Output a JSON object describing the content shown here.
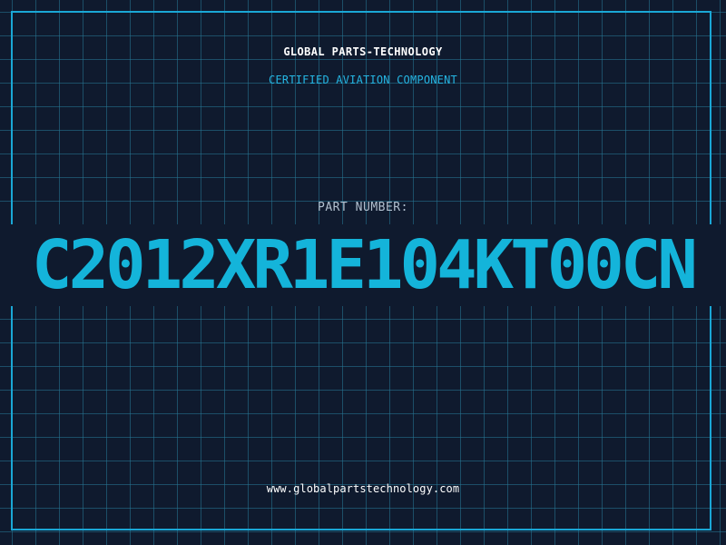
{
  "header": {
    "company": "GLOBAL PARTS-TECHNOLOGY",
    "subtitle": "CERTIFIED AVIATION COMPONENT"
  },
  "main": {
    "label": "PART NUMBER:",
    "part_number": "C2012XR1E104KT00CN"
  },
  "footer": {
    "url": "www.globalpartstechnology.com"
  },
  "colors": {
    "background": "#0f1a2e",
    "grid": "#267896",
    "accent": "#14b4da",
    "frame": "#1aa7d6",
    "label": "#b2c0cf"
  }
}
